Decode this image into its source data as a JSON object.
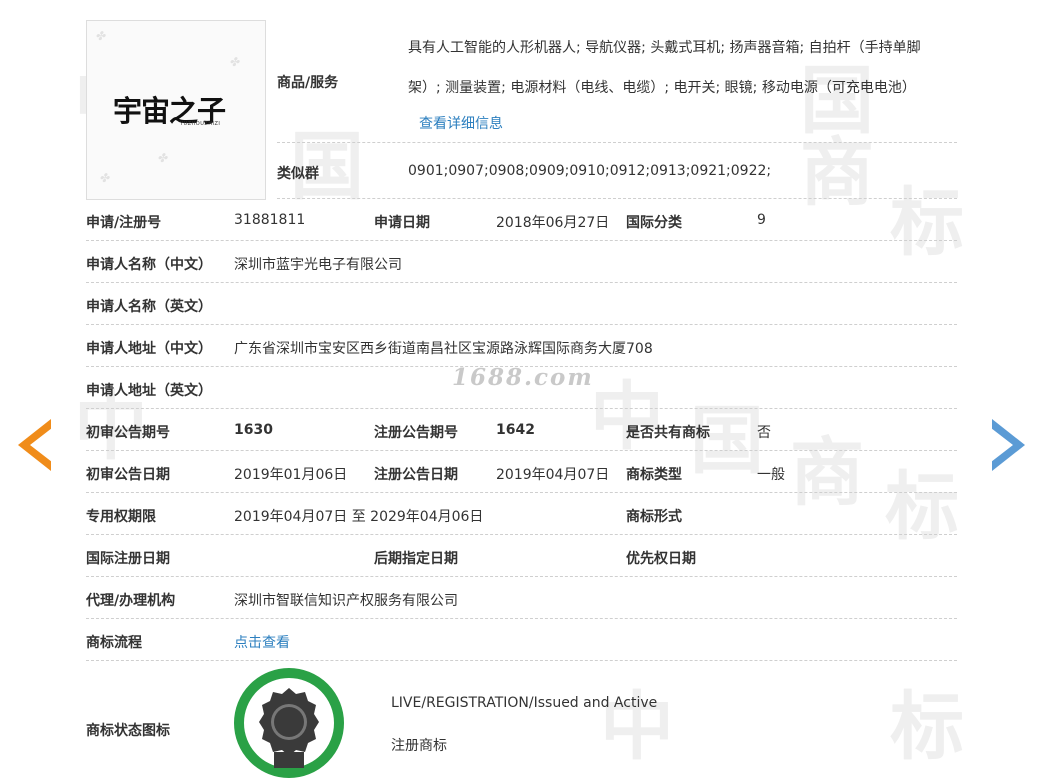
{
  "logo": {
    "name": "宇宙之子",
    "sub": "YUZHOUZHIZI"
  },
  "watermark_site": "1688.com",
  "goods": {
    "label": "商品/服务",
    "text": "具有人工智能的人形机器人; 导航仪器; 头戴式耳机; 扬声器音箱; 自拍杆（手持单脚架）; 测量装置; 电源材料（电线、电缆）; 电开关; 眼镜; 移动电源（可充电电池）",
    "detail_link": "查看详细信息"
  },
  "similar_group": {
    "label": "类似群",
    "value": "0901;0907;0908;0909;0910;0912;0913;0921;0922;"
  },
  "rows": {
    "r1": {
      "l1": "申请/注册号",
      "v1": "31881811",
      "l2": "申请日期",
      "v2": "2018年06月27日",
      "l3": "国际分类",
      "v3": "9"
    },
    "r2": {
      "l1": "申请人名称（中文）",
      "v1": "深圳市蓝宇光电子有限公司"
    },
    "r3": {
      "l1": "申请人名称（英文）",
      "v1": ""
    },
    "r4": {
      "l1": "申请人地址（中文）",
      "v1": "广东省深圳市宝安区西乡街道南昌社区宝源路泳辉国际商务大厦708"
    },
    "r5": {
      "l1": "申请人地址（英文）",
      "v1": ""
    },
    "r6": {
      "l1": "初审公告期号",
      "v1": "1630",
      "l2": "注册公告期号",
      "v2": "1642",
      "l3": "是否共有商标",
      "v3": "否"
    },
    "r7": {
      "l1": "初审公告日期",
      "v1": "2019年01月06日",
      "l2": "注册公告日期",
      "v2": "2019年04月07日",
      "l3": "商标类型",
      "v3": "一般"
    },
    "r8": {
      "l1": "专用权期限",
      "v1": "2019年04月07日 至 2029年04月06日",
      "l3": "商标形式",
      "v3": ""
    },
    "r9": {
      "l1": "国际注册日期",
      "v1": "",
      "l2": "后期指定日期",
      "v2": "",
      "l3": "优先权日期",
      "v3": ""
    },
    "r10": {
      "l1": "代理/办理机构",
      "v1": "深圳市智联信知识产权服务有限公司"
    },
    "r11": {
      "l1": "商标流程",
      "link": "点击查看"
    }
  },
  "status": {
    "label": "商标状态图标",
    "en": "LIVE/REGISTRATION/Issued and Active",
    "cn": "注册商标"
  },
  "colors": {
    "accent_link": "#2c7fbf",
    "arrow_left": "#f08c1a",
    "arrow_right": "#5b9bd5",
    "badge": "#2aa146"
  },
  "icons": {
    "prev": "prev-arrow-icon",
    "next": "next-arrow-icon",
    "status": "registered-badge-icon"
  }
}
